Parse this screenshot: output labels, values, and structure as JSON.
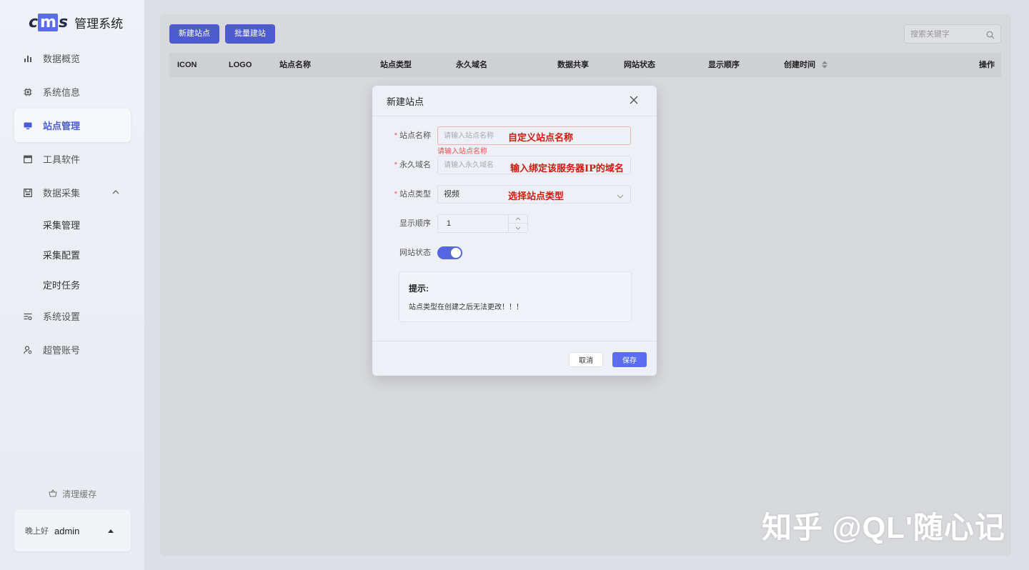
{
  "app": {
    "logo_text_pre": "c",
    "logo_text_mid": "m",
    "logo_text_post": "s",
    "title": "管理系统"
  },
  "sidebar": {
    "items": [
      {
        "label": "数据概览",
        "icon": "bar-chart-icon"
      },
      {
        "label": "系统信息",
        "icon": "chip-icon"
      },
      {
        "label": "站点管理",
        "icon": "monitor-icon",
        "active": true
      },
      {
        "label": "工具软件",
        "icon": "window-icon"
      },
      {
        "label": "数据采集",
        "icon": "save-icon",
        "expanded": true
      }
    ],
    "submenu": [
      {
        "label": "采集管理"
      },
      {
        "label": "采集配置"
      },
      {
        "label": "定时任务"
      }
    ],
    "items_after": [
      {
        "label": "系统设置",
        "icon": "settings-sliders-icon"
      },
      {
        "label": "超管账号",
        "icon": "user-gear-icon"
      }
    ],
    "clear_cache": "清理缓存",
    "greeting": "晚上好",
    "username": "admin"
  },
  "toolbar": {
    "new_site": "新建站点",
    "batch_create": "批量建站",
    "search_placeholder": "搜索关键字"
  },
  "table": {
    "columns": [
      "ICON",
      "LOGO",
      "站点名称",
      "站点类型",
      "永久域名",
      "数据共享",
      "网站状态",
      "显示顺序",
      "创建时间",
      "操作"
    ]
  },
  "modal": {
    "title": "新建站点",
    "fields": {
      "site_name": {
        "label": "站点名称",
        "placeholder": "请输入站点名称",
        "value": "",
        "error": "请输入站点名称",
        "required": true
      },
      "domain": {
        "label": "永久域名",
        "placeholder": "请输入永久域名",
        "value": "",
        "required": true
      },
      "site_type": {
        "label": "站点类型",
        "value": "视频",
        "required": true
      },
      "order": {
        "label": "显示顺序",
        "value": "1"
      },
      "status": {
        "label": "网站状态",
        "on": true
      }
    },
    "annotations": {
      "site_name": "自定义站点名称",
      "domain": "输入绑定该服务器IP的域名",
      "site_type": "选择站点类型"
    },
    "tip_title": "提示:",
    "tip_text": "站点类型在创建之后无法更改！！！",
    "cancel": "取消",
    "save": "保存"
  },
  "watermark": "知乎 @QL'随心记",
  "colors": {
    "primary": "#4d5bd1",
    "accent": "#5b6df0",
    "error": "#e45656",
    "annotation": "#d0190f"
  }
}
